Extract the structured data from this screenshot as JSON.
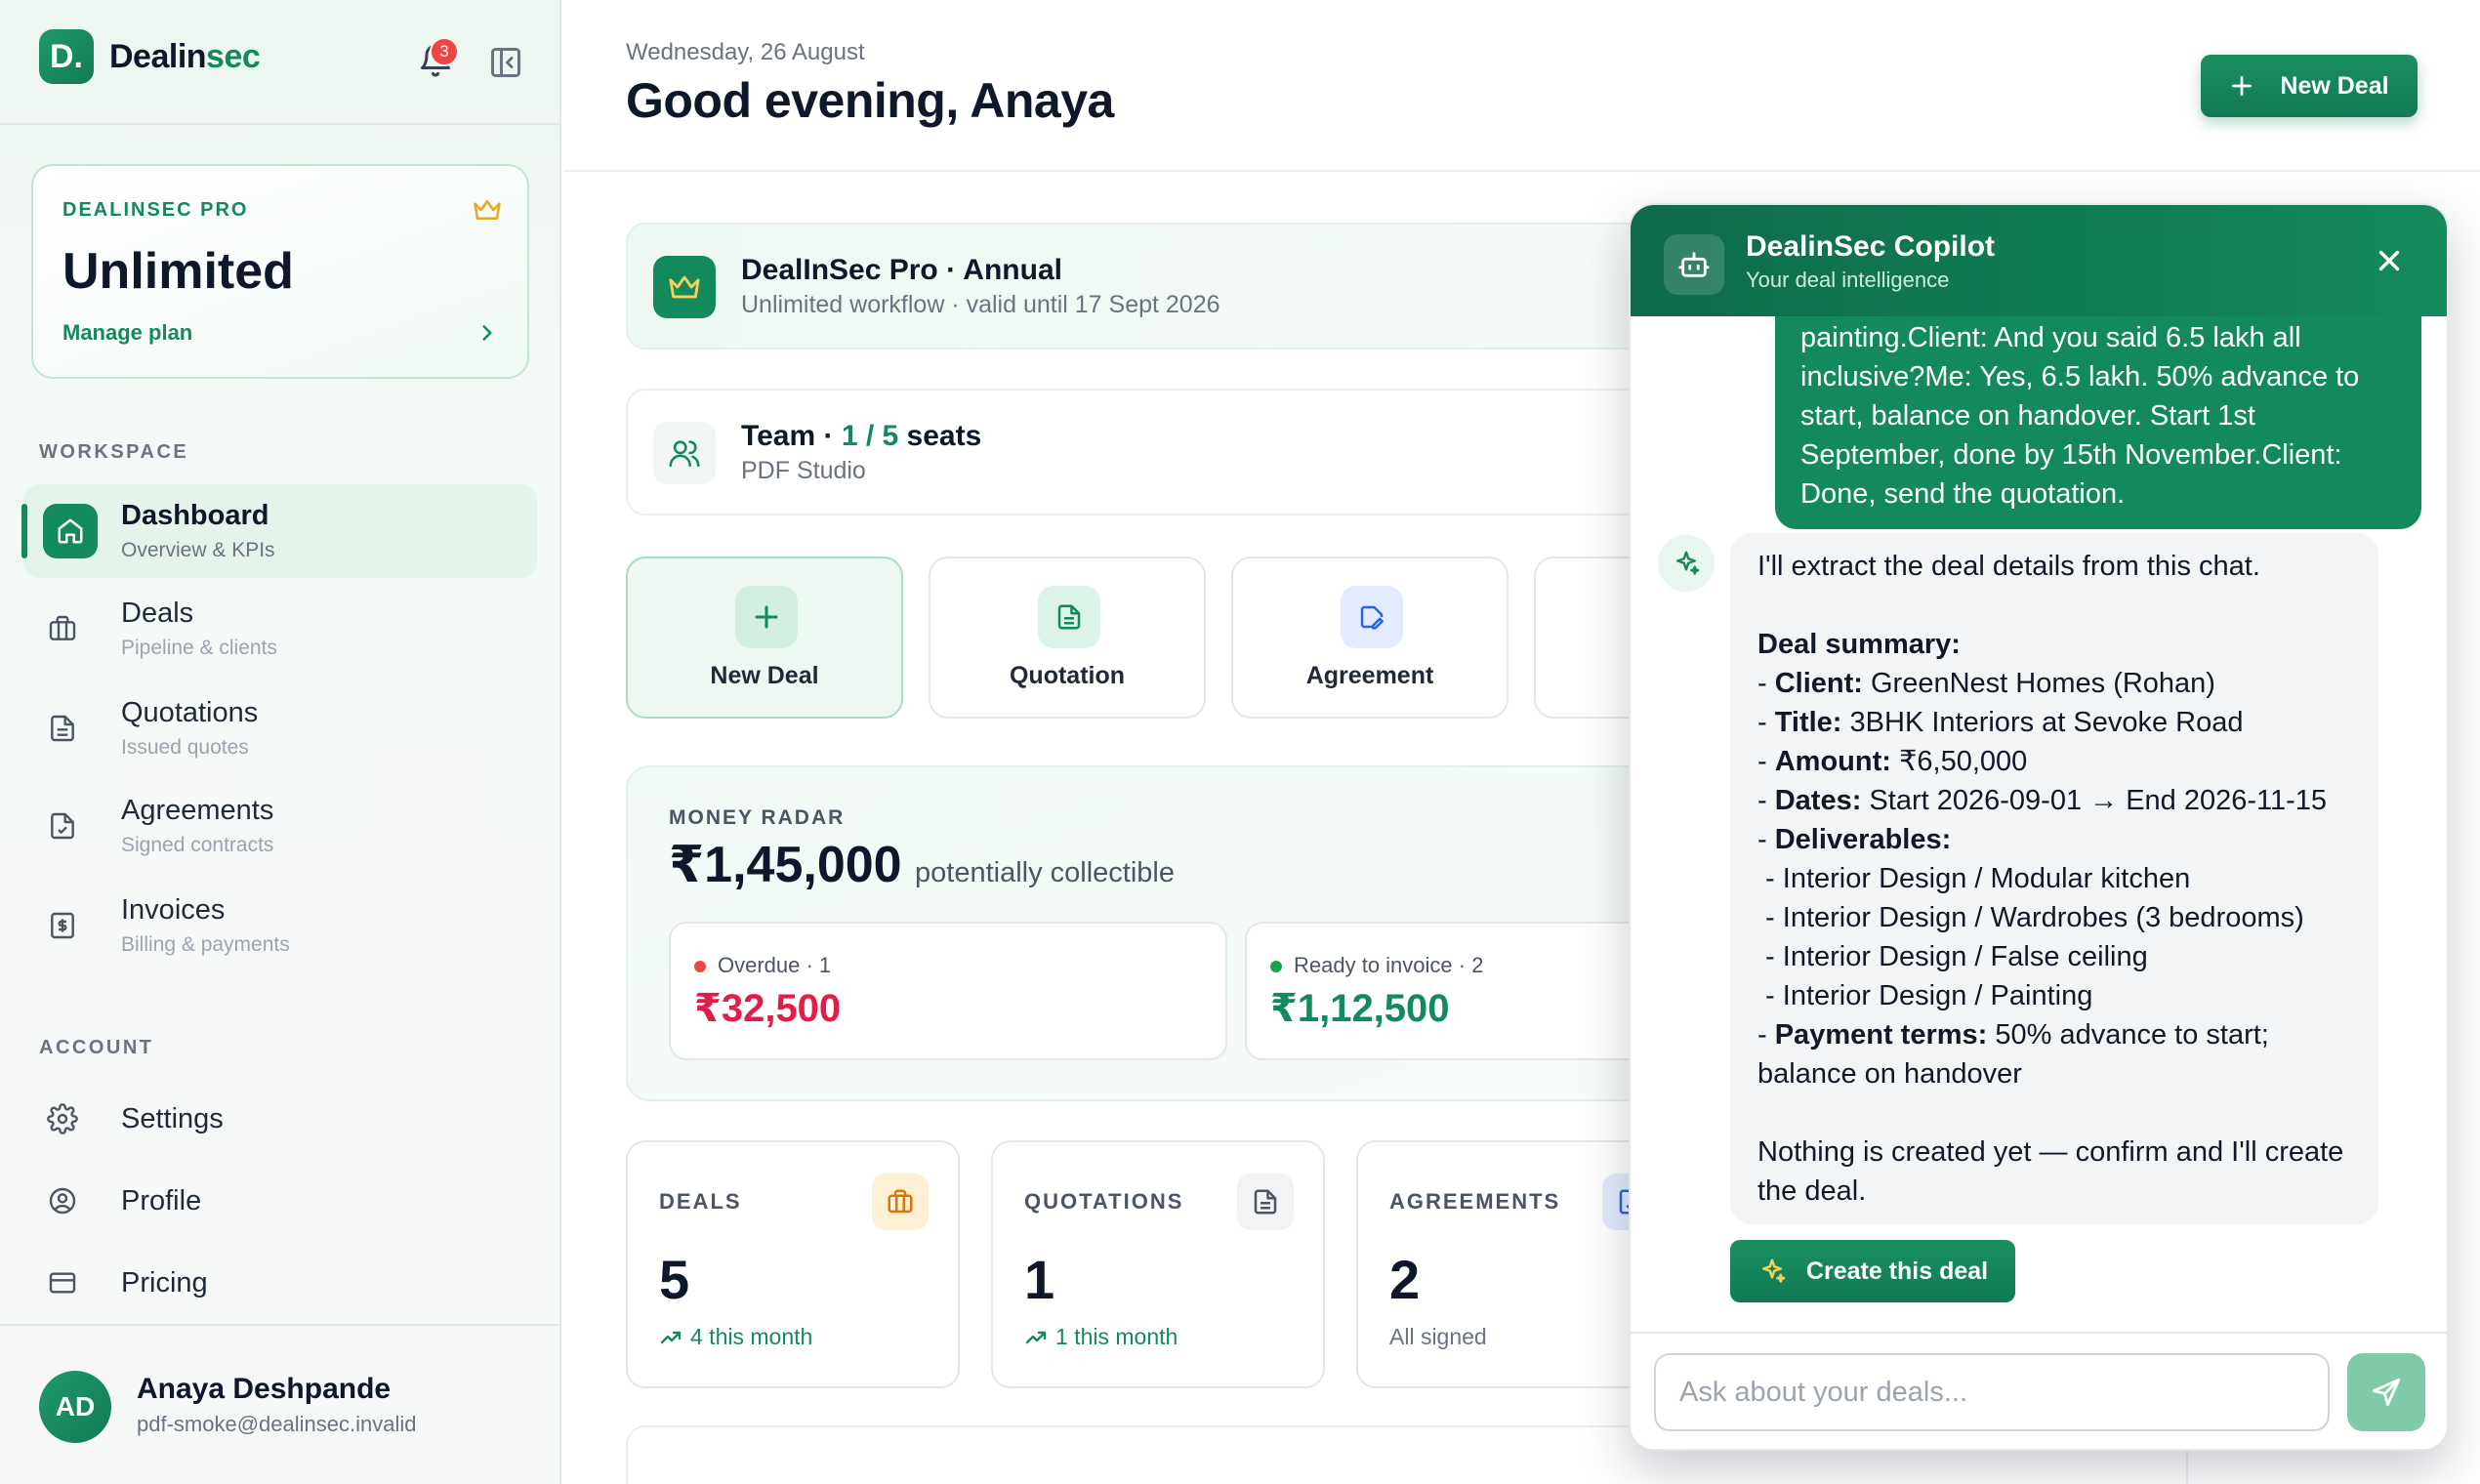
{
  "sidebar": {
    "brand": {
      "logo_letter": "D.",
      "name_prefix": "Dealin",
      "name_accent": "sec"
    },
    "notifications_count": "3",
    "plan": {
      "kicker": "DEALINSEC PRO",
      "title": "Unlimited",
      "link": "Manage plan"
    },
    "workspace_label": "WORKSPACE",
    "nav": [
      {
        "title": "Dashboard",
        "subtitle": "Overview & KPIs",
        "icon": "home-icon",
        "active": true
      },
      {
        "title": "Deals",
        "subtitle": "Pipeline & clients",
        "icon": "briefcase-icon"
      },
      {
        "title": "Quotations",
        "subtitle": "Issued quotes",
        "icon": "document-icon"
      },
      {
        "title": "Agreements",
        "subtitle": "Signed contracts",
        "icon": "document-check-icon"
      },
      {
        "title": "Invoices",
        "subtitle": "Billing & payments",
        "icon": "receipt-icon"
      }
    ],
    "account_label": "ACCOUNT",
    "account": [
      {
        "title": "Settings",
        "icon": "gear-icon"
      },
      {
        "title": "Profile",
        "icon": "user-circle-icon"
      },
      {
        "title": "Pricing",
        "icon": "credit-card-icon"
      }
    ],
    "user": {
      "initials": "AD",
      "name": "Anaya Deshpande",
      "email": "pdf-smoke@dealinsec.invalid"
    }
  },
  "header": {
    "date": "Wednesday, 26 August",
    "greeting": "Good evening, Anaya",
    "new_deal": "New Deal"
  },
  "subscription": {
    "title": "DealInSec Pro · Annual",
    "desc": "Unlimited workflow · valid until 17 Sept 2026"
  },
  "team": {
    "title_prefix": "Team · ",
    "seats_used": "1 / 5",
    "title_suffix": " seats",
    "desc": "PDF Studio"
  },
  "actions": [
    {
      "label": "New Deal",
      "icon": "plus-icon"
    },
    {
      "label": "Quotation",
      "icon": "document-icon"
    },
    {
      "label": "Agreement",
      "icon": "pen-document-icon"
    },
    {
      "label": "",
      "icon": ""
    }
  ],
  "radar": {
    "kicker": "MONEY RADAR",
    "amount": "₹1,45,000",
    "note": "potentially collectible",
    "overdue": {
      "label": "Overdue · 1",
      "value": "₹32,500"
    },
    "ready": {
      "label": "Ready to invoice · 2",
      "value": "₹1,12,500"
    }
  },
  "kpis": [
    {
      "label": "DEALS",
      "value": "5",
      "sub": "4 this month",
      "icon": "briefcase-icon"
    },
    {
      "label": "QUOTATIONS",
      "value": "1",
      "sub": "1 this month",
      "icon": "document-icon"
    },
    {
      "label": "AGREEMENTS",
      "value": "2",
      "sub": "All signed",
      "icon": "document-check-icon"
    }
  ],
  "copilot": {
    "title": "DealinSec Copilot",
    "subtitle": "Your deal intelligence",
    "user_message": "painting.Client: And you said 6.5 lakh all inclusive?Me: Yes, 6.5 lakh. 50% advance to start, balance on handover. Start 1st September, done by 15th November.Client: Done, send the quotation.",
    "reply": {
      "intro": "I'll extract the deal details from this chat.",
      "summary_heading": "Deal summary:",
      "client_label": "Client:",
      "client": " GreenNest Homes (Rohan)",
      "title_label": "Title:",
      "title": " 3BHK Interiors at Sevoke Road",
      "amount_label": "Amount:",
      "amount": " ₹6,50,000",
      "dates_label": "Dates:",
      "dates": " Start 2026-09-01 → End 2026-11-15",
      "deliverables_label": "Deliverables:",
      "deliverables": [
        " - Interior Design / Modular kitchen",
        " - Interior Design / Wardrobes (3 bedrooms)",
        " - Interior Design / False ceiling",
        " - Interior Design / Painting"
      ],
      "terms_label": "Payment terms:",
      "terms": " 50% advance to start; balance on handover",
      "closing": "Nothing is created yet — confirm and I'll create the deal."
    },
    "create_button": "Create this deal",
    "input_placeholder": "Ask about your deals..."
  },
  "colors": {
    "brand": "#138a5c",
    "danger": "#e11d48",
    "accent_gold": "#e5a823"
  }
}
